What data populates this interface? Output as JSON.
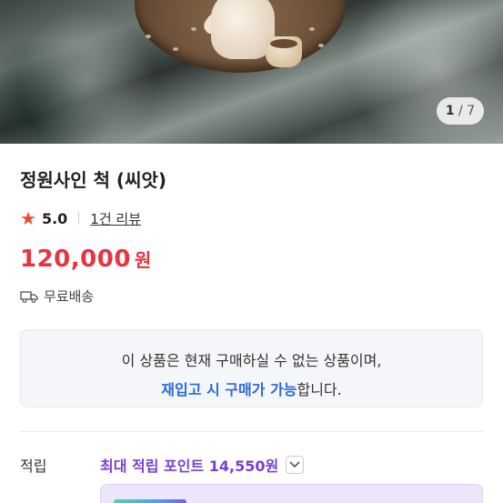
{
  "gallery": {
    "current": "1",
    "separator": "/",
    "total": "7"
  },
  "product": {
    "title": "정원사인 척 (씨앗)",
    "rating": "5.0",
    "review_link": "1건 리뷰",
    "price": "120,000",
    "price_unit": "원",
    "shipping": "무료배송"
  },
  "notice": {
    "line1": "이 상품은 현재 구매하실 수 없는 상품이며,",
    "line2_highlight": "재입고 시 구매가 가능",
    "line2_rest": "합니다."
  },
  "points": {
    "label": "적립",
    "max_points": "최대 적립 포인트 14,550원"
  },
  "colors": {
    "accent_red": "#e8343f",
    "star": "#f04b2d",
    "link_blue": "#2a6ad8",
    "points_purple": "#7b3fd0"
  }
}
